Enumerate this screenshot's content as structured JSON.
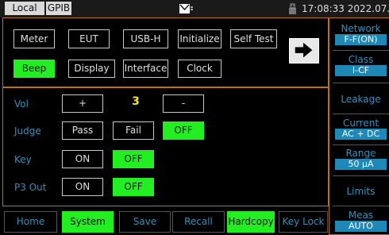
{
  "status_bar": {
    "local_label": "Local",
    "gpib_label": "GPIB",
    "mail_icon": "mail-icon",
    "usb_icon": "usb-icon",
    "clock_text": "17:08:33 2022.07.21"
  },
  "top_panel": {
    "row1": [
      "Meter",
      "EUT",
      "USB-H",
      "Initialize",
      "Self Test"
    ],
    "row2": [
      "Beep",
      "Display",
      "Interface",
      "Clock"
    ],
    "active": "Beep",
    "next_icon": "arrow-right-icon"
  },
  "settings": {
    "vol_label": "Vol",
    "vol_plus": "+",
    "vol_value": "3",
    "vol_minus": "-",
    "judge_label": "Judge",
    "judge_pass": "Pass",
    "judge_fail": "Fail",
    "judge_off": "OFF",
    "judge_selected": "OFF",
    "key_label": "Key",
    "key_on": "ON",
    "key_off": "OFF",
    "key_selected": "OFF",
    "p3out_label": "P3 Out",
    "p3out_on": "ON",
    "p3out_off": "OFF",
    "p3out_selected": "OFF"
  },
  "right_panel": {
    "network_title": "Network",
    "network_value": "F-F(ON)",
    "class_title": "Class",
    "class_value": "I-CF",
    "leakage_label": "Leakage",
    "current_title": "Current",
    "current_value": "AC + DC",
    "range_title": "Range",
    "range_value": "50 µA",
    "limits_label": "Limits",
    "meas_title": "Meas",
    "meas_value": "AUTO"
  },
  "bottom_bar": {
    "items": [
      "Home",
      "System",
      "Save",
      "Recall",
      "Hardcopy",
      "Key Lock"
    ],
    "active": [
      "System",
      "Hardcopy"
    ]
  },
  "colors": {
    "accent_green": "#22ee22",
    "label_blue": "#3a8fb7",
    "value_bg_blue": "#1e89b6",
    "frame_orange": "#c07010",
    "volume_yellow": "#f2e23a"
  }
}
